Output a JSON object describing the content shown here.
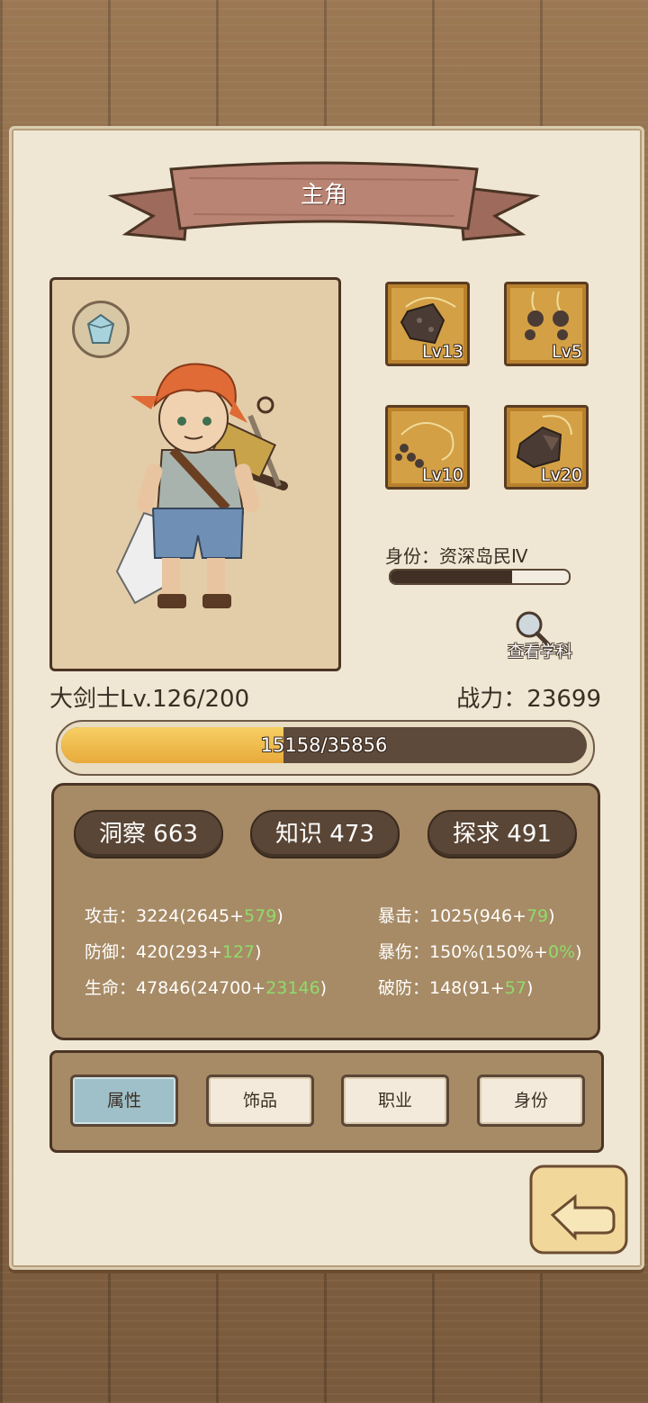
{
  "header": {
    "title": "主角"
  },
  "equipment": [
    {
      "slot": 1,
      "icon": "rock-necklace-icon",
      "level": "Lv13"
    },
    {
      "slot": 2,
      "icon": "stone-earrings-icon",
      "level": "Lv5"
    },
    {
      "slot": 3,
      "icon": "pebble-necklace-icon",
      "level": "Lv10"
    },
    {
      "slot": 4,
      "icon": "rock-amulet-icon",
      "level": "Lv20"
    }
  ],
  "identity": {
    "label": "身份：资深岛民Ⅳ",
    "progress": 0.68
  },
  "view_subject": {
    "label": "查看学科",
    "icon": "magnifier-icon"
  },
  "character": {
    "class_level": "大剑士Lv.126/200",
    "power": "战力：23699"
  },
  "experience": {
    "text": "15158/35856",
    "current": 15158,
    "max": 35856
  },
  "attributes": [
    {
      "label": "洞察 663"
    },
    {
      "label": "知识 473"
    },
    {
      "label": "探求 491"
    }
  ],
  "stats": {
    "attack": {
      "base": "攻击：3224(2645+",
      "bonus": "579",
      "end": ")"
    },
    "crit": {
      "base": "暴击：1025(946+",
      "bonus": "79",
      "end": ")"
    },
    "defense": {
      "base": "防御：420(293+",
      "bonus": "127",
      "end": ")"
    },
    "crit_damage": {
      "base": "暴伤：150%(150%+",
      "bonus": "0%",
      "end": ")"
    },
    "hp": {
      "base": "生命：47846(24700+",
      "bonus": "23146",
      "end": ")"
    },
    "penetration": {
      "base": "破防：148(91+",
      "bonus": "57",
      "end": ")"
    }
  },
  "tabs": [
    {
      "label": "属性",
      "active": true
    },
    {
      "label": "饰品",
      "active": false
    },
    {
      "label": "职业",
      "active": false
    },
    {
      "label": "身份",
      "active": false
    }
  ],
  "colors": {
    "panel": "#efe7d3",
    "ribbon": "#b98474",
    "exp_fill": "#f2bf50",
    "bonus": "#8fdc6a",
    "active_tab": "#9fc0c8"
  }
}
